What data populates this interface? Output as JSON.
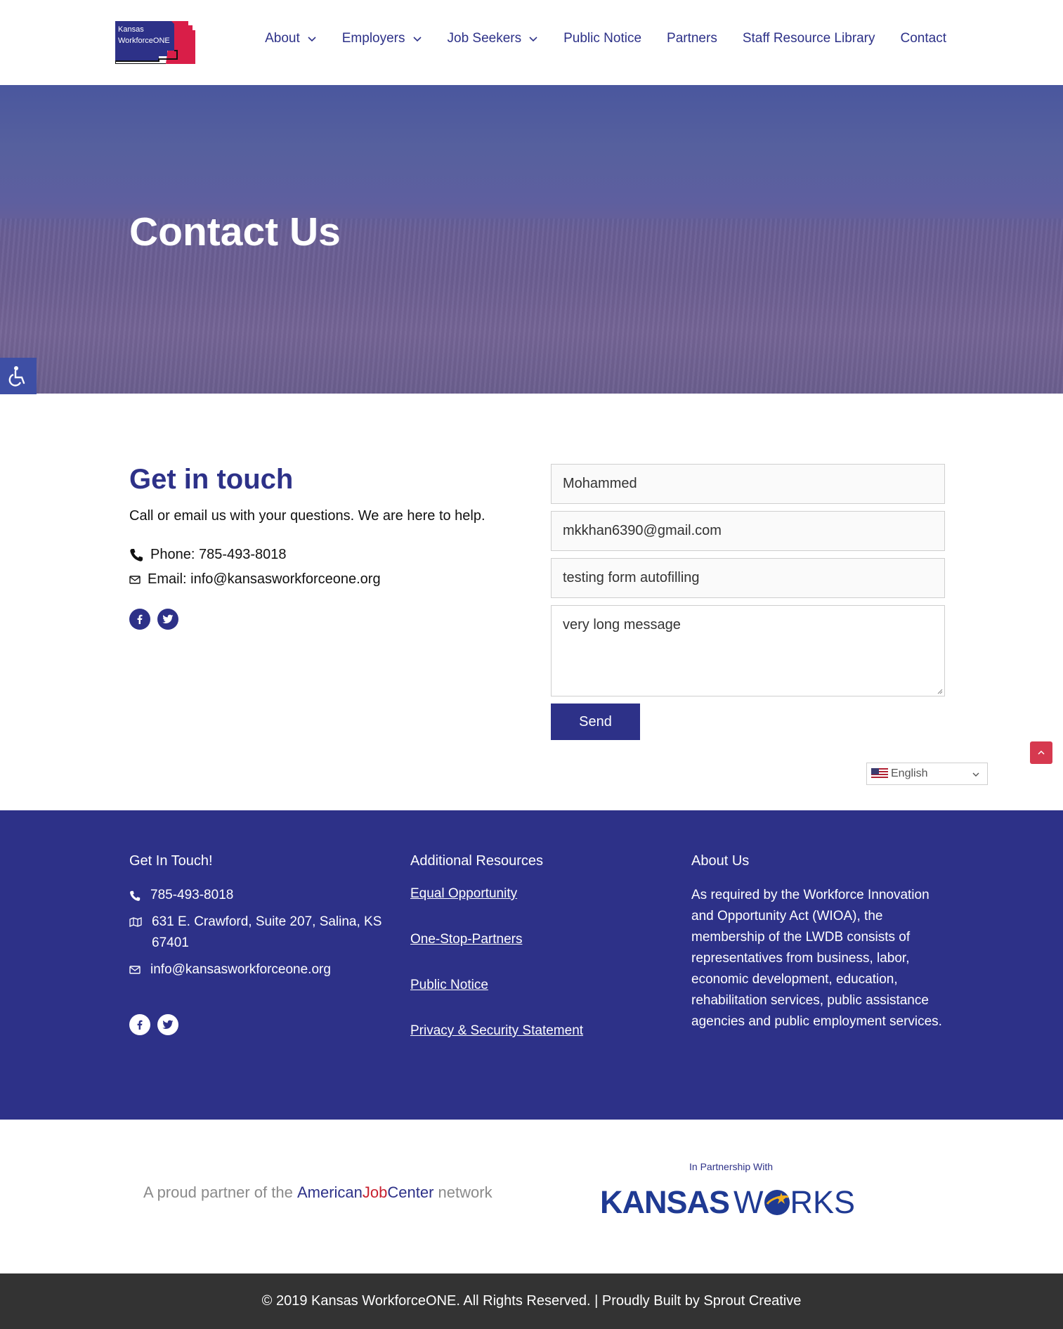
{
  "header": {
    "logo": {
      "line1": "Kansas",
      "line2": "WorkforceONE"
    },
    "nav": [
      {
        "label": "About",
        "has_dropdown": true
      },
      {
        "label": "Employers",
        "has_dropdown": true
      },
      {
        "label": "Job Seekers",
        "has_dropdown": true
      },
      {
        "label": "Public Notice",
        "has_dropdown": false
      },
      {
        "label": "Partners",
        "has_dropdown": false
      },
      {
        "label": "Staff Resource Library",
        "has_dropdown": false
      },
      {
        "label": "Contact",
        "has_dropdown": false
      }
    ]
  },
  "hero": {
    "title": "Contact Us"
  },
  "contact": {
    "title": "Get in touch",
    "subtitle": "Call or email us with your questions. We are here to help.",
    "phone": "Phone: 785-493-8018",
    "email": "Email: info@kansasworkforceone.org",
    "social_icons": [
      "facebook-icon",
      "twitter-icon"
    ]
  },
  "form": {
    "name_value": "Mohammed",
    "email_value": "mkkhan6390@gmail.com",
    "subject_value": "testing form autofilling",
    "message_value": "very long message",
    "send_label": "Send"
  },
  "language": {
    "selected": "English"
  },
  "footer": {
    "col1": {
      "title": "Get In Touch!",
      "phone": "785-493-8018",
      "address": "631 E. Crawford, Suite 207, Salina, KS 67401",
      "email": "info@kansasworkforceone.org"
    },
    "col2": {
      "title": "Additional Resources",
      "links": [
        "Equal Opportunity",
        "One-Stop-Partners",
        "Public Notice",
        "Privacy & Security Statement"
      ]
    },
    "col3": {
      "title": "About Us",
      "text": "As required by the Workforce Innovation and Opportunity Act (WIOA), the membership of the LWDB consists of representatives from business, labor, economic development, education, rehabilitation services, public assistance agencies and public employment services."
    }
  },
  "partners": {
    "ajc_prefix": "A proud partner of the",
    "ajc_american": "American",
    "ajc_job": "Job",
    "ajc_center": "Center",
    "ajc_suffix": "network",
    "in_partnership": "In Partnership With",
    "kansas": "KANSAS",
    "works_w": "W",
    "works_rest": "RKS"
  },
  "copyright": "© 2019 Kansas WorkforceONE. All Rights Reserved. | Proudly Built by Sprout Creative",
  "colors": {
    "brand_navy": "#2d3188",
    "accent_red": "#d6394f",
    "footer_dark": "#333333"
  }
}
